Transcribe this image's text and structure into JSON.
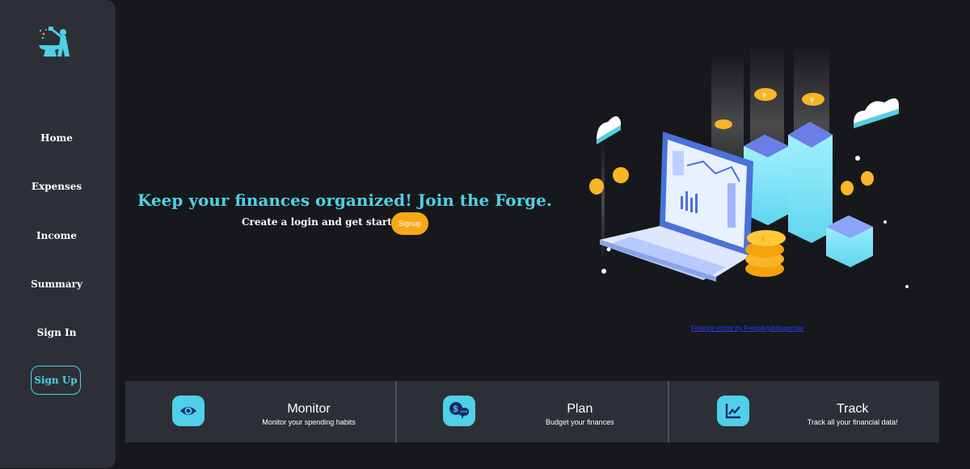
{
  "colors": {
    "accent": "#4fd0e8",
    "cta": "#f9a815",
    "sidebar": "#2c3036",
    "background": "#17181b"
  },
  "logo": {
    "icon": "blacksmith-anvil-icon"
  },
  "nav": {
    "home": "Home",
    "expenses": "Expenses",
    "income": "Income",
    "summary": "Summary",
    "sign_in": "Sign In",
    "sign_up": "Sign Up"
  },
  "hero": {
    "headline": "Keep your finances organized! Join the Forge.",
    "subline": "Create a login and get started!",
    "signup_label": "Signup",
    "credit": "Finance vector by Freepik/pikisuperstar"
  },
  "features": [
    {
      "title": "Monitor",
      "desc": "Monitor your spending habits",
      "icon": "eye-icon"
    },
    {
      "title": "Plan",
      "desc": "Budget your finances",
      "icon": "money-chat-icon"
    },
    {
      "title": "Track",
      "desc": "Track all your financial data!",
      "icon": "line-chart-icon"
    }
  ]
}
